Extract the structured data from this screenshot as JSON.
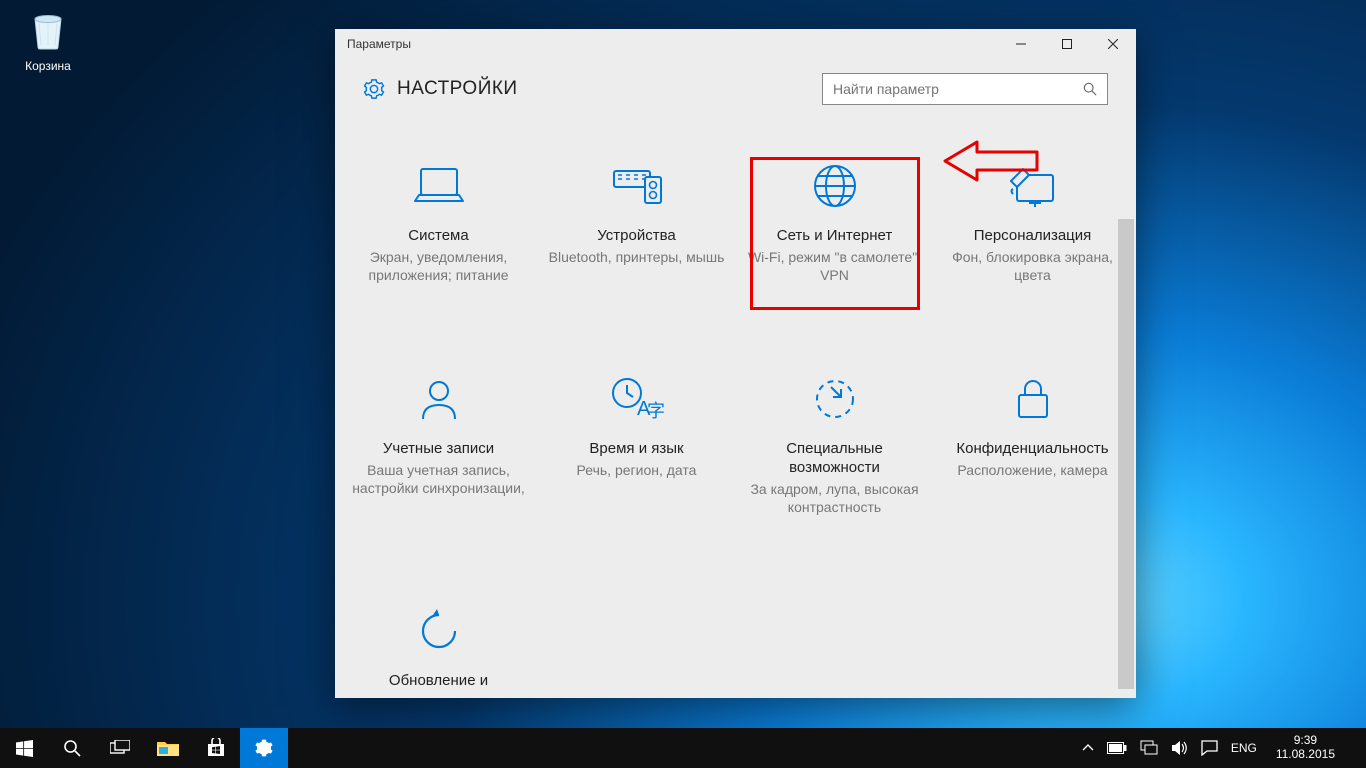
{
  "desktop": {
    "recycle_label": "Корзина"
  },
  "window": {
    "title": "Параметры",
    "heading": "НАСТРОЙКИ",
    "search_placeholder": "Найти параметр"
  },
  "tiles": {
    "system": {
      "title": "Система",
      "sub": "Экран, уведомления, приложения; питание"
    },
    "devices": {
      "title": "Устройства",
      "sub": "Bluetooth, принтеры, мышь"
    },
    "network": {
      "title": "Сеть и Интернет",
      "sub": "Wi-Fi, режим \"в самолете\", VPN"
    },
    "personalize": {
      "title": "Персонализация",
      "sub": "Фон, блокировка экрана, цвета"
    },
    "accounts": {
      "title": "Учетные записи",
      "sub": "Ваша учетная запись, настройки синхронизации,"
    },
    "timelang": {
      "title": "Время и язык",
      "sub": "Речь, регион, дата"
    },
    "ease": {
      "title": "Специальные возможности",
      "sub": "За кадром, лупа, высокая контрастность"
    },
    "privacy": {
      "title": "Конфиденциальность",
      "sub": "Расположение, камера"
    },
    "update": {
      "title": "Обновление и",
      "sub": ""
    }
  },
  "taskbar": {
    "lang": "ENG",
    "time": "9:39",
    "date": "11.08.2015"
  },
  "colors": {
    "accent": "#0078d7",
    "annotation": "#e60000"
  }
}
